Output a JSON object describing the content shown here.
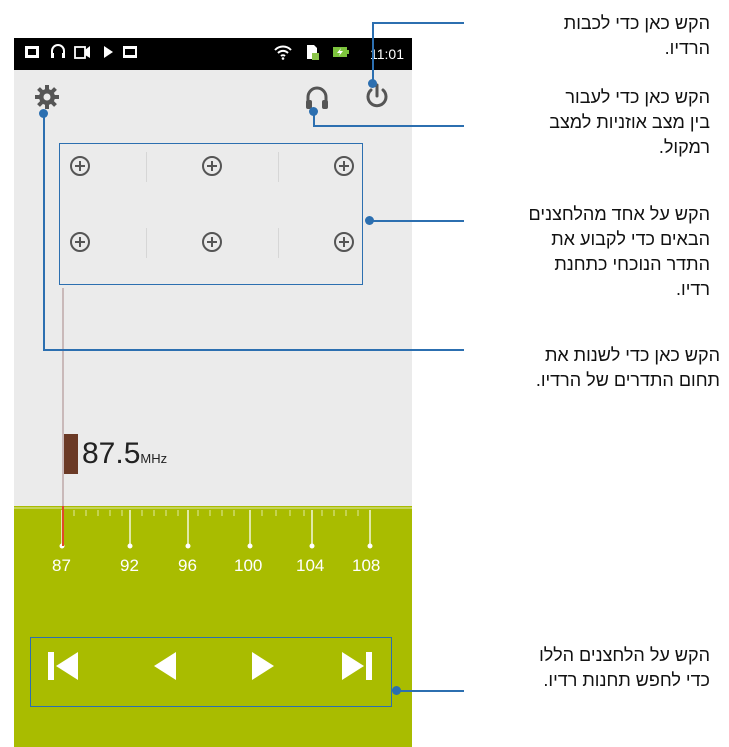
{
  "status_bar": {
    "time": "11:01",
    "icons": [
      "sim-icon",
      "headset-icon",
      "notification-icon",
      "play-icon",
      "gallery-icon",
      "wifi-icon",
      "sim-card-icon",
      "battery-charging-icon"
    ]
  },
  "radio": {
    "frequency_value": "87.5",
    "frequency_unit": "MHz",
    "scale_labels": [
      "87",
      "92",
      "96",
      "100",
      "104",
      "108"
    ],
    "preset_slots": 6
  },
  "annotations": {
    "power": "הקש כאן כדי לכבות\nהרדיו.",
    "headphone": "הקש כאן כדי לעבור\nבין מצב אוזניות למצב\nרמקול.",
    "presets": "הקש על אחד מהלחצנים\nהבאים כדי לקבוע את\nהתדר הנוכחי כתחנת\nרדיו.",
    "band": "הקש כאן כדי לשנות את\nתחום התדרים של הרדיו.",
    "seek": "הקש על הלחצנים הללו\nכדי לחפש תחנות רדיו."
  },
  "colors": {
    "accent_blue": "#2c6fb0",
    "scale_green": "#a9bc00",
    "tuner_brown": "#6b3a26"
  }
}
